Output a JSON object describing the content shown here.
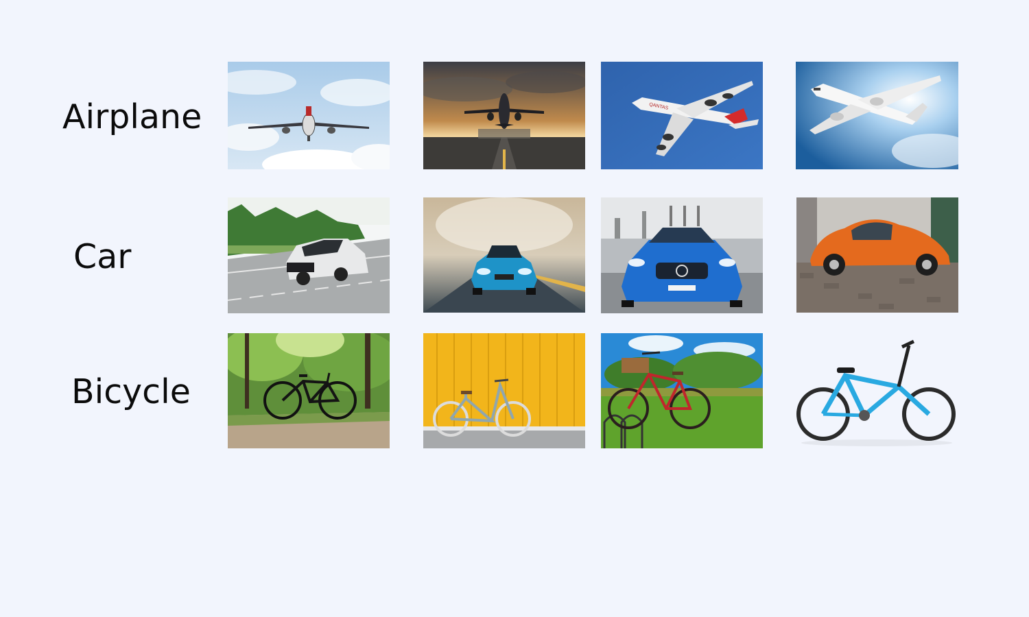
{
  "rows": [
    {
      "label": "Airplane",
      "images": [
        {
          "icon": "airplane-landing-cloudy-sky"
        },
        {
          "icon": "airplane-takeoff-sunset-runway"
        },
        {
          "icon": "qantas-airplane-blue-sky",
          "text": "QANTAS"
        },
        {
          "icon": "white-airplane-blue-sky"
        }
      ]
    },
    {
      "label": "Car",
      "images": [
        {
          "icon": "white-suv-highway"
        },
        {
          "icon": "blue-sports-car-road"
        },
        {
          "icon": "blue-mercedes-parking-lot"
        },
        {
          "icon": "orange-beetle-cobblestone"
        }
      ]
    },
    {
      "label": "Bicycle",
      "images": [
        {
          "icon": "black-bicycle-forest-path"
        },
        {
          "icon": "grey-bicycle-yellow-wall"
        },
        {
          "icon": "red-bicycle-park"
        },
        {
          "icon": "blue-kids-bicycle-white"
        }
      ]
    }
  ],
  "colors": {
    "background": "#f2f5fd",
    "label_text": "#0b0b0b"
  }
}
